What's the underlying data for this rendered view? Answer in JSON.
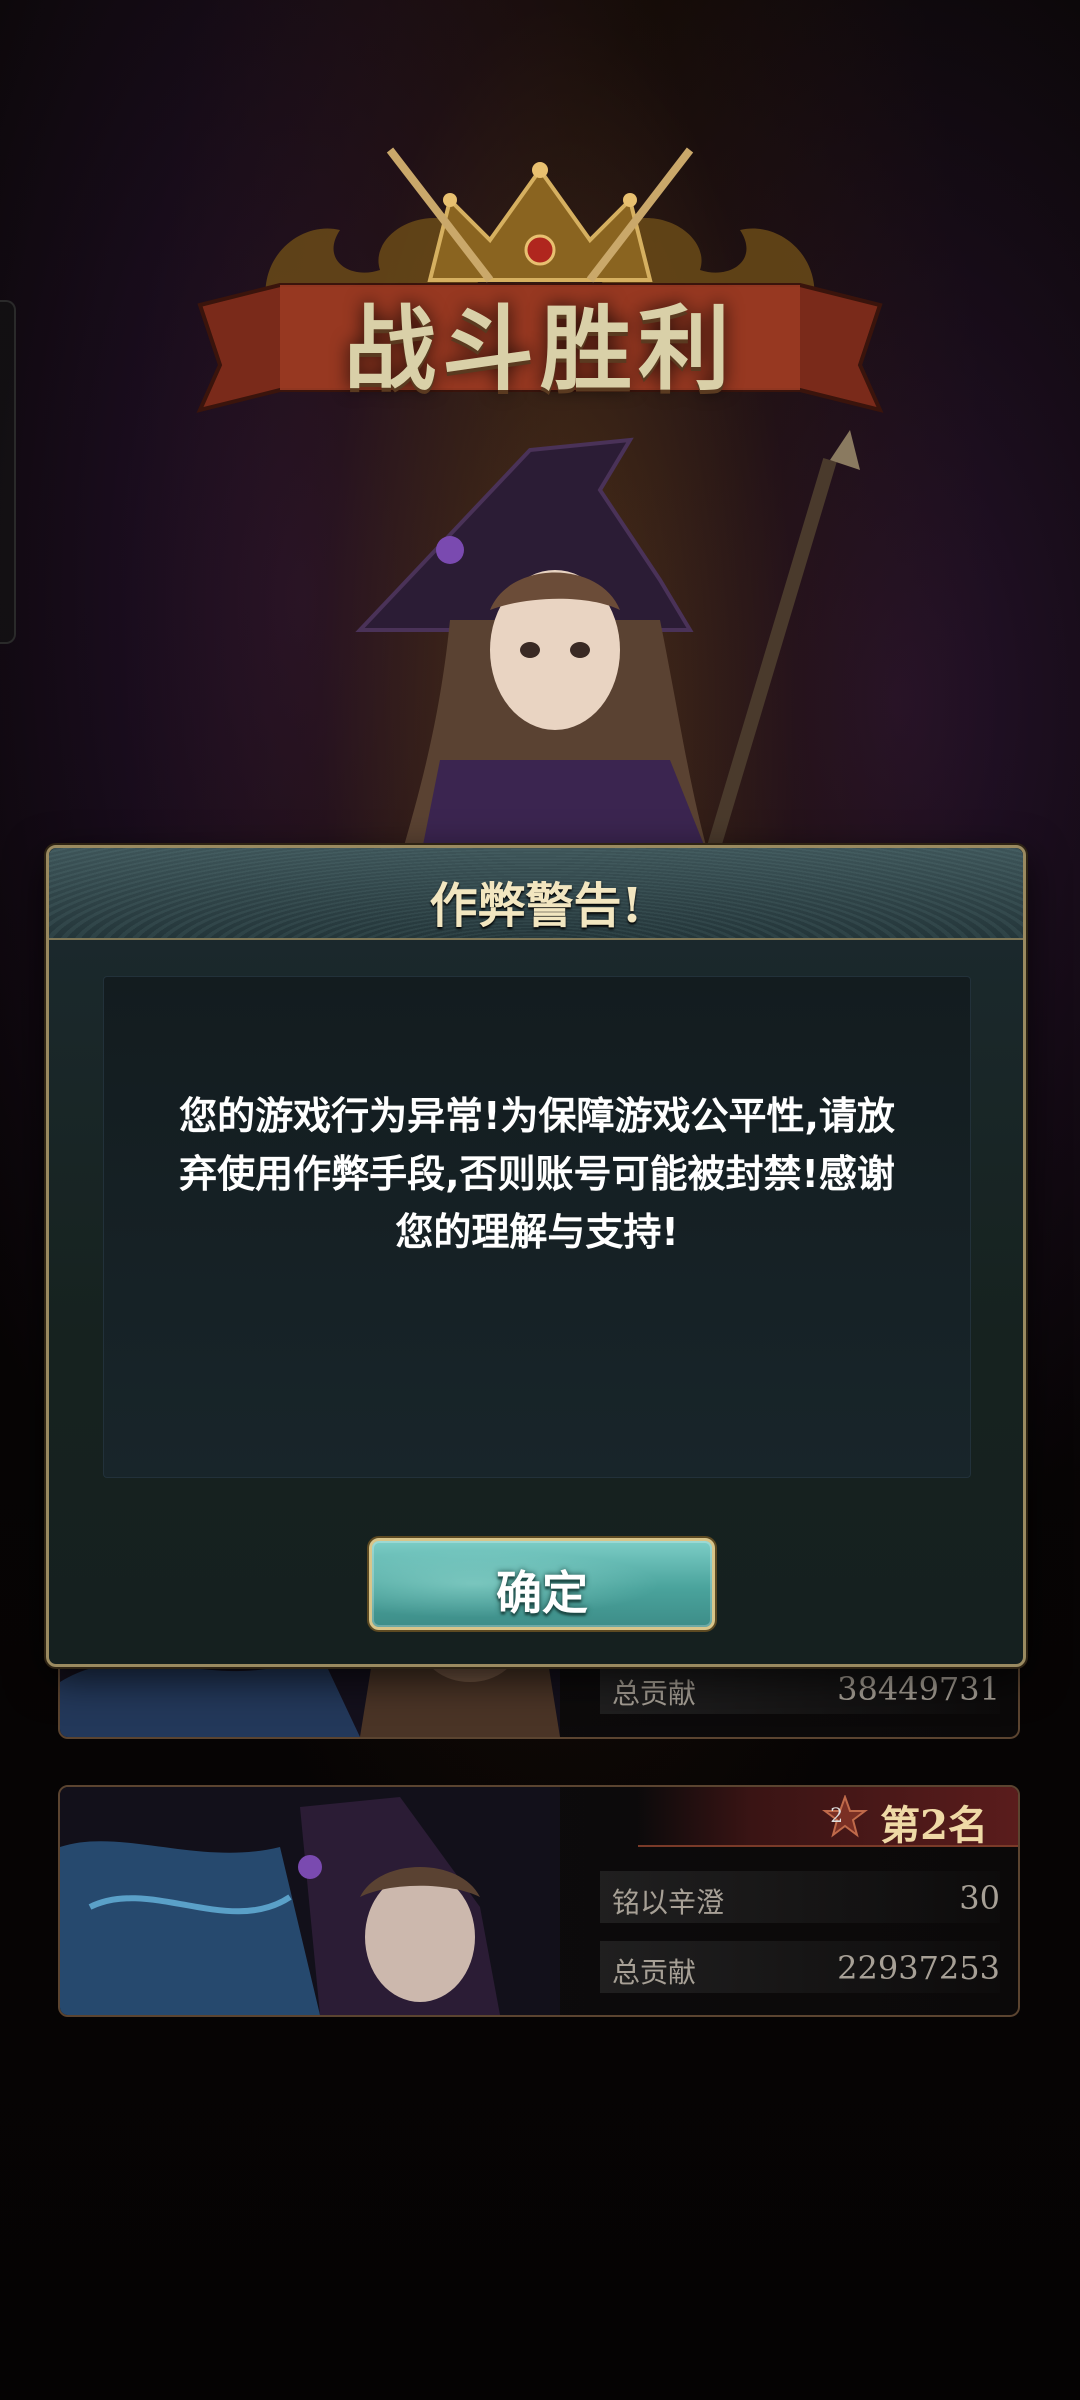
{
  "banner": {
    "title": "战斗胜利"
  },
  "dialog": {
    "title": "作弊警告!",
    "message_lines": [
      "您的游戏行为异常!为保障游戏公平性,请放",
      "弃使用作弊手段,否则账号可能被封禁!感谢",
      "您的理解与支持!"
    ],
    "confirm_label": "确定"
  },
  "rankings": [
    {
      "rank_number": "",
      "rank_label": "",
      "stats": [
        {
          "label": "总贡献",
          "value": "38449731"
        }
      ]
    },
    {
      "rank_number": "2",
      "rank_label": "第2名",
      "stats": [
        {
          "label": "铭以辛澄",
          "value": "30"
        },
        {
          "label": "总贡献",
          "value": "22937253"
        }
      ]
    }
  ],
  "colors": {
    "dialog_border": "#9a8a60",
    "button_teal": "#4aa39c",
    "title_gold": "#f2e6c0",
    "rank_red": "#5a1c1c"
  }
}
